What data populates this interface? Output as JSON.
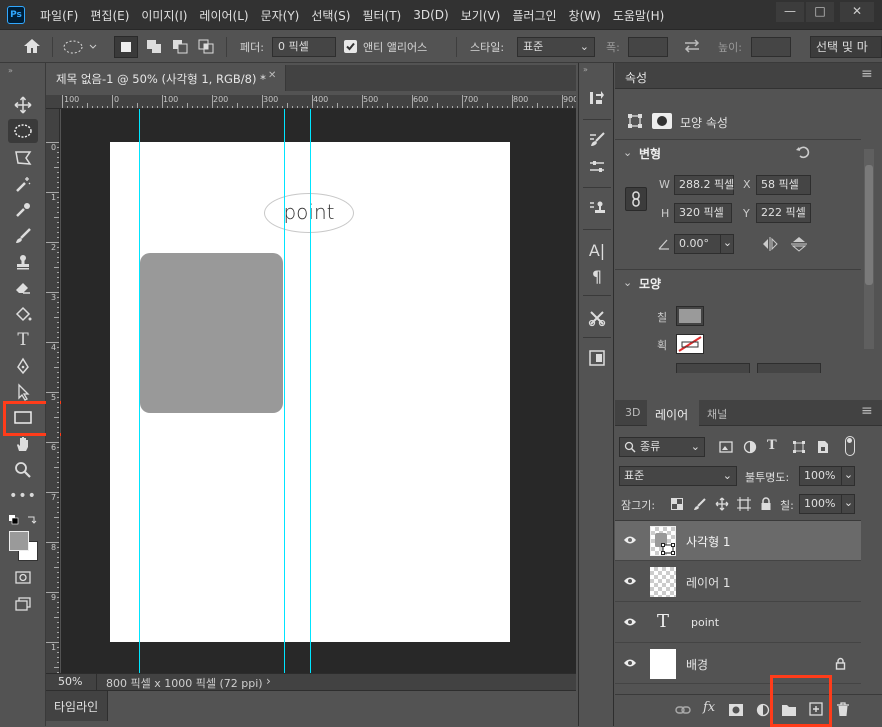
{
  "app": {
    "logo": "Ps"
  },
  "menu": [
    "파일(F)",
    "편집(E)",
    "이미지(I)",
    "레이어(L)",
    "문자(Y)",
    "선택(S)",
    "필터(T)",
    "3D(D)",
    "보기(V)",
    "플러그인",
    "창(W)",
    "도움말(H)"
  ],
  "window": {
    "minimize": "—",
    "maximize": "□",
    "close": "✕"
  },
  "options": {
    "feather_label": "페더:",
    "feather_value": "0 픽셀",
    "antialias_label": "앤티 앨리어스",
    "antialias_checked": true,
    "style_label": "스타일:",
    "style_value": "표준",
    "width_label": "폭:",
    "height_label": "높이:",
    "select_mask": "선택 및 마"
  },
  "document": {
    "tab_title": "제목 없음-1 @ 50% (사각형 1, RGB/8) *",
    "tab_close": "✕",
    "text_layer": "point",
    "zoom": "50%",
    "doc_info": "800 픽셀 x 1000 픽셀 (72 ppi)",
    "status_arrow": "›"
  },
  "rulers": {
    "h_ticks": [
      "100",
      "0",
      "100",
      "200",
      "300",
      "400",
      "500",
      "600",
      "700",
      "800",
      "900"
    ],
    "v_ticks": [
      "0",
      "1",
      "2",
      "3",
      "4",
      "5",
      "6",
      "7",
      "8",
      "9",
      "1"
    ]
  },
  "timeline": {
    "label": "타임라인"
  },
  "properties": {
    "tab": "속성",
    "shape_props": "모양 속성",
    "transform_section": "변형",
    "w_label": "W",
    "w_value": "288.2 픽셀",
    "h_label": "H",
    "h_value": "320 픽셀",
    "x_label": "X",
    "x_value": "58 픽셀",
    "y_label": "Y",
    "y_value": "222 픽셀",
    "angle_value": "0.00°",
    "shape_section": "모양",
    "fill_label": "칠",
    "stroke_label": "획",
    "fill_color": "#9a9a9a"
  },
  "layers_panel": {
    "tabs": [
      "3D",
      "레이어",
      "채널"
    ],
    "active_tab": "레이어",
    "filter_value": "종류",
    "blend_mode": "표준",
    "opacity_label": "불투명도:",
    "opacity_value": "100%",
    "lock_label": "잠그기:",
    "fill_label": "칠:",
    "fill_value": "100%",
    "layers": [
      {
        "name": "사각형 1",
        "type": "shape",
        "selected": true
      },
      {
        "name": "레이어 1",
        "type": "pixel",
        "selected": false
      },
      {
        "name": "point",
        "type": "text",
        "selected": false
      },
      {
        "name": "배경",
        "type": "background",
        "selected": false,
        "locked": true
      }
    ]
  },
  "colors": {
    "accent": "#ff3c1a",
    "guide": "#00e5ff",
    "selected_row": "#6a6a6a"
  }
}
